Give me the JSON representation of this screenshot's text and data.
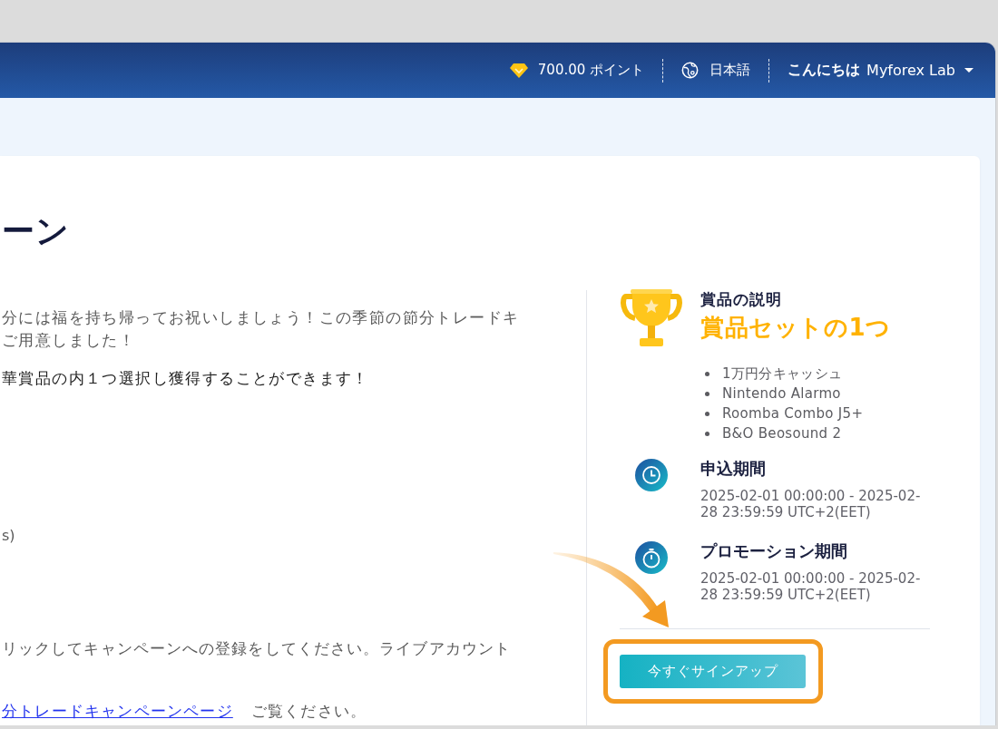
{
  "header": {
    "points": "700.00 ポイント",
    "language": "日本語",
    "greeting": "こんにちは",
    "user_name": "Myforex Lab"
  },
  "campaign": {
    "title_fragment": "ーン",
    "intro_lines": [
      "分には福を持ち帰ってお祝いしましょう！この季節の節分トレードキ",
      "ご用意しました！"
    ],
    "highlight_line": "華賞品の内１つ選択し獲得することができます！",
    "fragment": "s)",
    "instruction_line": "リックしてキャンペーンへの登録をしてください。ライブアカウント",
    "link": "分トレードキャンペーンページ",
    "link_suffix": "ご覧ください。"
  },
  "prize_panel": {
    "label": "賞品の説明",
    "headline": "賞品セットの1つ",
    "prizes": [
      "1万円分キャッシュ",
      "Nintendo Alarmo",
      "Roomba Combo J5+",
      "B&O Beosound 2"
    ],
    "periods": [
      {
        "kind": "clock",
        "title": "申込期間",
        "range": "2025-02-01 00:00:00 - 2025-02-28 23:59:59 UTC+2(EET)"
      },
      {
        "kind": "stopwatch",
        "title": "プロモーション期間",
        "range": "2025-02-01 00:00:00 - 2025-02-28 23:59:59 UTC+2(EET)"
      }
    ],
    "signup_button": "今すぐサインアップ"
  }
}
